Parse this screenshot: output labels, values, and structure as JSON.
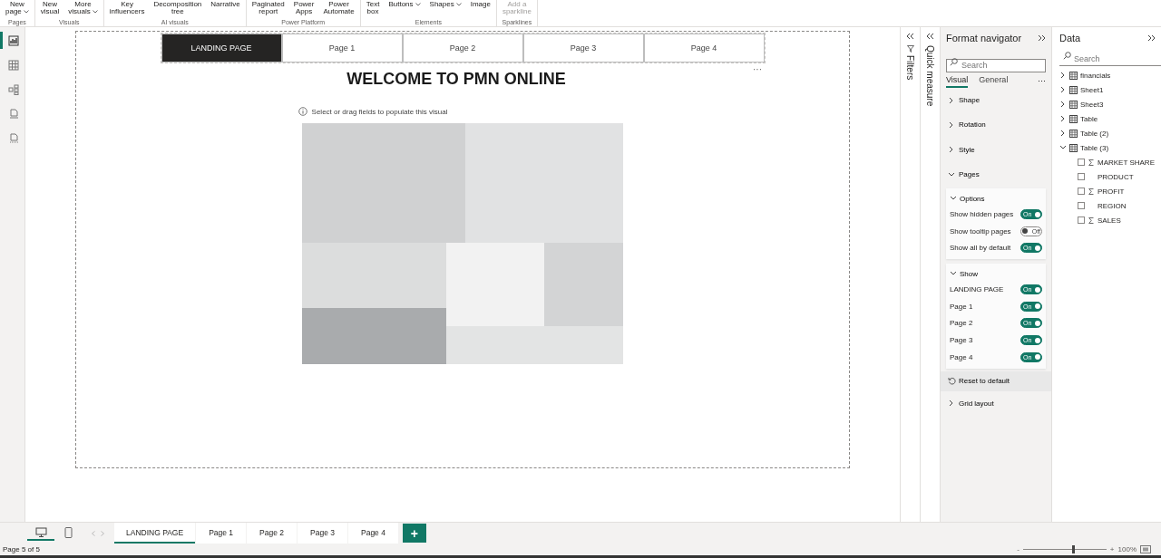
{
  "ribbon": {
    "groups": [
      {
        "label": "Pages",
        "buttons": [
          {
            "lines": [
              "New",
              "page"
            ],
            "dropdown": true,
            "disabled": false
          }
        ]
      },
      {
        "label": "Visuals",
        "buttons": [
          {
            "lines": [
              "New",
              "visual"
            ],
            "dropdown": false,
            "disabled": false
          },
          {
            "lines": [
              "More",
              "visuals"
            ],
            "dropdown": true,
            "disabled": false
          }
        ]
      },
      {
        "label": "AI visuals",
        "buttons": [
          {
            "lines": [
              "Key",
              "influencers"
            ],
            "dropdown": false,
            "disabled": false
          },
          {
            "lines": [
              "Decomposition",
              "tree"
            ],
            "dropdown": false,
            "disabled": false
          },
          {
            "lines": [
              "Narrative"
            ],
            "dropdown": false,
            "disabled": false
          }
        ]
      },
      {
        "label": "Power Platform",
        "buttons": [
          {
            "lines": [
              "Paginated",
              "report"
            ],
            "dropdown": false,
            "disabled": false
          },
          {
            "lines": [
              "Power",
              "Apps"
            ],
            "dropdown": false,
            "disabled": false
          },
          {
            "lines": [
              "Power",
              "Automate"
            ],
            "dropdown": false,
            "disabled": false
          }
        ]
      },
      {
        "label": "Elements",
        "buttons": [
          {
            "lines": [
              "Text",
              "box"
            ],
            "dropdown": false,
            "disabled": false
          },
          {
            "lines": [
              "Buttons"
            ],
            "dropdown": true,
            "disabled": false
          },
          {
            "lines": [
              "Shapes"
            ],
            "dropdown": true,
            "disabled": false
          },
          {
            "lines": [
              "Image"
            ],
            "dropdown": false,
            "disabled": false
          }
        ]
      },
      {
        "label": "Sparklines",
        "buttons": [
          {
            "lines": [
              "Add a",
              "sparkline"
            ],
            "dropdown": false,
            "disabled": true
          }
        ]
      }
    ]
  },
  "view_rail": [
    {
      "kind": "report",
      "selected": true
    },
    {
      "kind": "table",
      "selected": false
    },
    {
      "kind": "model",
      "selected": false
    },
    {
      "kind": "dax",
      "selected": false
    },
    {
      "kind": "tmdl",
      "selected": false
    }
  ],
  "canvas": {
    "nav_buttons": [
      {
        "label": "LANDING PAGE",
        "selected": true
      },
      {
        "label": "Page 1",
        "selected": false
      },
      {
        "label": "Page 2",
        "selected": false
      },
      {
        "label": "Page 3",
        "selected": false
      },
      {
        "label": "Page 4",
        "selected": false
      }
    ],
    "more": "···",
    "title": "WELCOME TO PMN ONLINE",
    "info": "Select or drag fields to populate this visual"
  },
  "filters": {
    "label": "Filters"
  },
  "quick_measure": {
    "label": "Quick measure"
  },
  "format_navigator": {
    "title": "Format navigator",
    "search_placeholder": "Search",
    "tabs": [
      {
        "label": "Visual",
        "selected": true
      },
      {
        "label": "General",
        "selected": false
      }
    ],
    "more": "···",
    "sections": [
      {
        "label": "Shape",
        "expanded": false
      },
      {
        "label": "Rotation",
        "expanded": false
      },
      {
        "label": "Style",
        "expanded": false
      },
      {
        "label": "Pages",
        "expanded": true,
        "cards": [
          {
            "label": "Options",
            "expanded": true,
            "toggles": [
              {
                "label": "Show hidden pages",
                "on": true,
                "text": "On"
              },
              {
                "label": "Show tooltip pages",
                "on": false,
                "text": "Off"
              },
              {
                "label": "Show all by default",
                "on": true,
                "text": "On"
              }
            ]
          },
          {
            "label": "Show",
            "expanded": true,
            "toggles": [
              {
                "label": "LANDING PAGE",
                "on": true,
                "text": "On"
              },
              {
                "label": "Page 1",
                "on": true,
                "text": "On"
              },
              {
                "label": "Page 2",
                "on": true,
                "text": "On"
              },
              {
                "label": "Page 3",
                "on": true,
                "text": "On"
              },
              {
                "label": "Page 4",
                "on": true,
                "text": "On"
              }
            ]
          }
        ],
        "reset": "Reset to default"
      },
      {
        "label": "Grid layout",
        "expanded": false
      }
    ]
  },
  "data_pane": {
    "title": "Data",
    "search_placeholder": "Search",
    "tables": [
      {
        "name": "financials",
        "expanded": false
      },
      {
        "name": "Sheet1",
        "expanded": false
      },
      {
        "name": "Sheet3",
        "expanded": false
      },
      {
        "name": "Table",
        "expanded": false
      },
      {
        "name": "Table (2)",
        "expanded": false
      },
      {
        "name": "Table (3)",
        "expanded": true,
        "children": [
          {
            "name": "MARKET SHARE",
            "kind": "measure",
            "checked": false
          },
          {
            "name": "PRODUCT",
            "kind": "text",
            "checked": false
          },
          {
            "name": "PROFIT",
            "kind": "measure",
            "checked": false
          },
          {
            "name": "REGION",
            "kind": "text",
            "checked": false
          },
          {
            "name": "SALES",
            "kind": "measure",
            "checked": false
          }
        ]
      }
    ]
  },
  "page_tabs": {
    "views": [
      {
        "kind": "desktop",
        "selected": true
      },
      {
        "kind": "mobile",
        "selected": false
      }
    ],
    "tabs": [
      {
        "label": "LANDING PAGE",
        "selected": true
      },
      {
        "label": "Page 1",
        "selected": false
      },
      {
        "label": "Page 2",
        "selected": false
      },
      {
        "label": "Page 3",
        "selected": false
      },
      {
        "label": "Page 4",
        "selected": false
      }
    ],
    "add": "+"
  },
  "status_bar": {
    "page": "Page 5 of 5",
    "zoom": {
      "level": 0.6,
      "minus": "-",
      "plus": "+",
      "reading": "100%"
    }
  }
}
